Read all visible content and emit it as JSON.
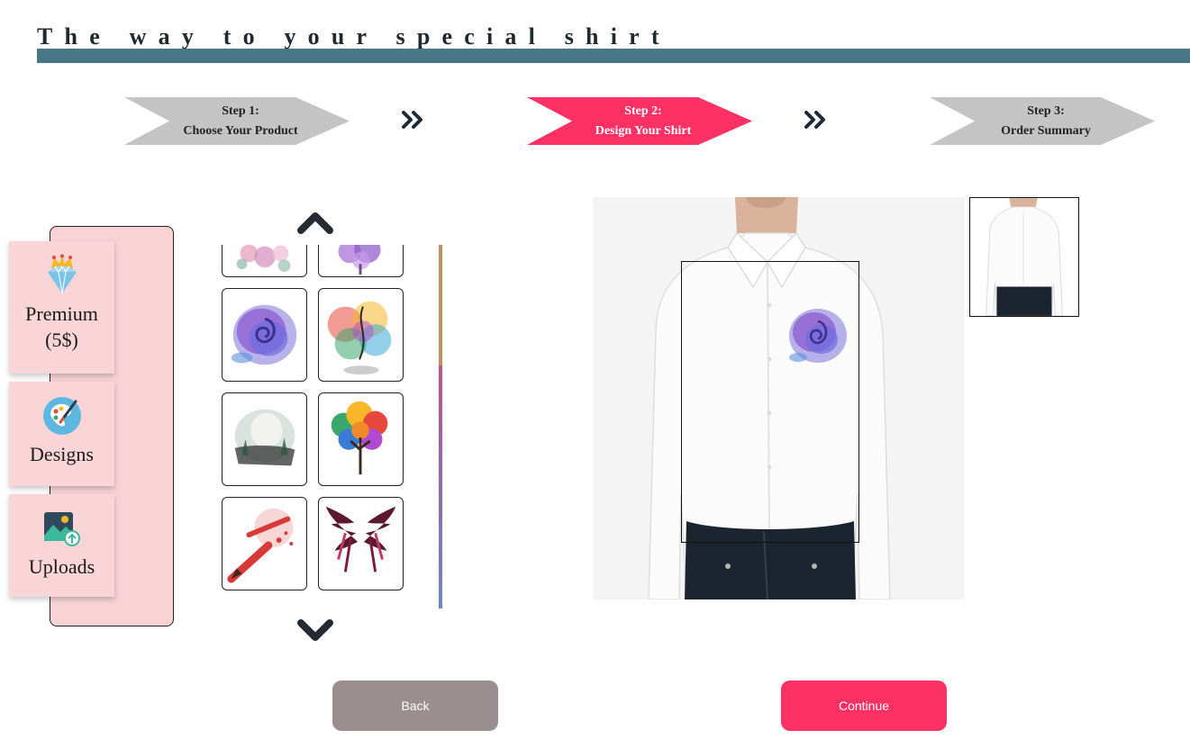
{
  "header": {
    "title": "The way to your special shirt"
  },
  "steps": [
    {
      "line1": "Step 1:",
      "line2": "Choose Your Product",
      "state": "inactive"
    },
    {
      "line1": "Step 2:",
      "line2": "Design Your Shirt",
      "state": "active"
    },
    {
      "line1": "Step 3:",
      "line2": "Order Summary",
      "state": "inactive"
    }
  ],
  "sidebar": {
    "items": [
      {
        "label_line1": "Premium",
        "label_line2": "(5$)",
        "icon": "diamond-crown-icon"
      },
      {
        "label": "Designs",
        "icon": "palette-icon"
      },
      {
        "label": "Uploads",
        "icon": "image-upload-icon"
      }
    ]
  },
  "gallery": {
    "items": [
      {
        "name": "flowers-bouquet",
        "visibility": "partial"
      },
      {
        "name": "purple-tree",
        "visibility": "partial"
      },
      {
        "name": "purple-rose"
      },
      {
        "name": "rainbow-splash-figure"
      },
      {
        "name": "snow-globe"
      },
      {
        "name": "rainbow-tree"
      },
      {
        "name": "pencil-idea"
      },
      {
        "name": "dark-wings"
      }
    ]
  },
  "preview": {
    "front_design": "purple-rose",
    "views": [
      "front",
      "back"
    ]
  },
  "buttons": {
    "back": "Back",
    "continue": "Continue"
  },
  "colors": {
    "accent": "#fe3165",
    "title_bar": "#4a7785",
    "panel": "#f7d3d6",
    "back_button": "#9a8e90"
  }
}
